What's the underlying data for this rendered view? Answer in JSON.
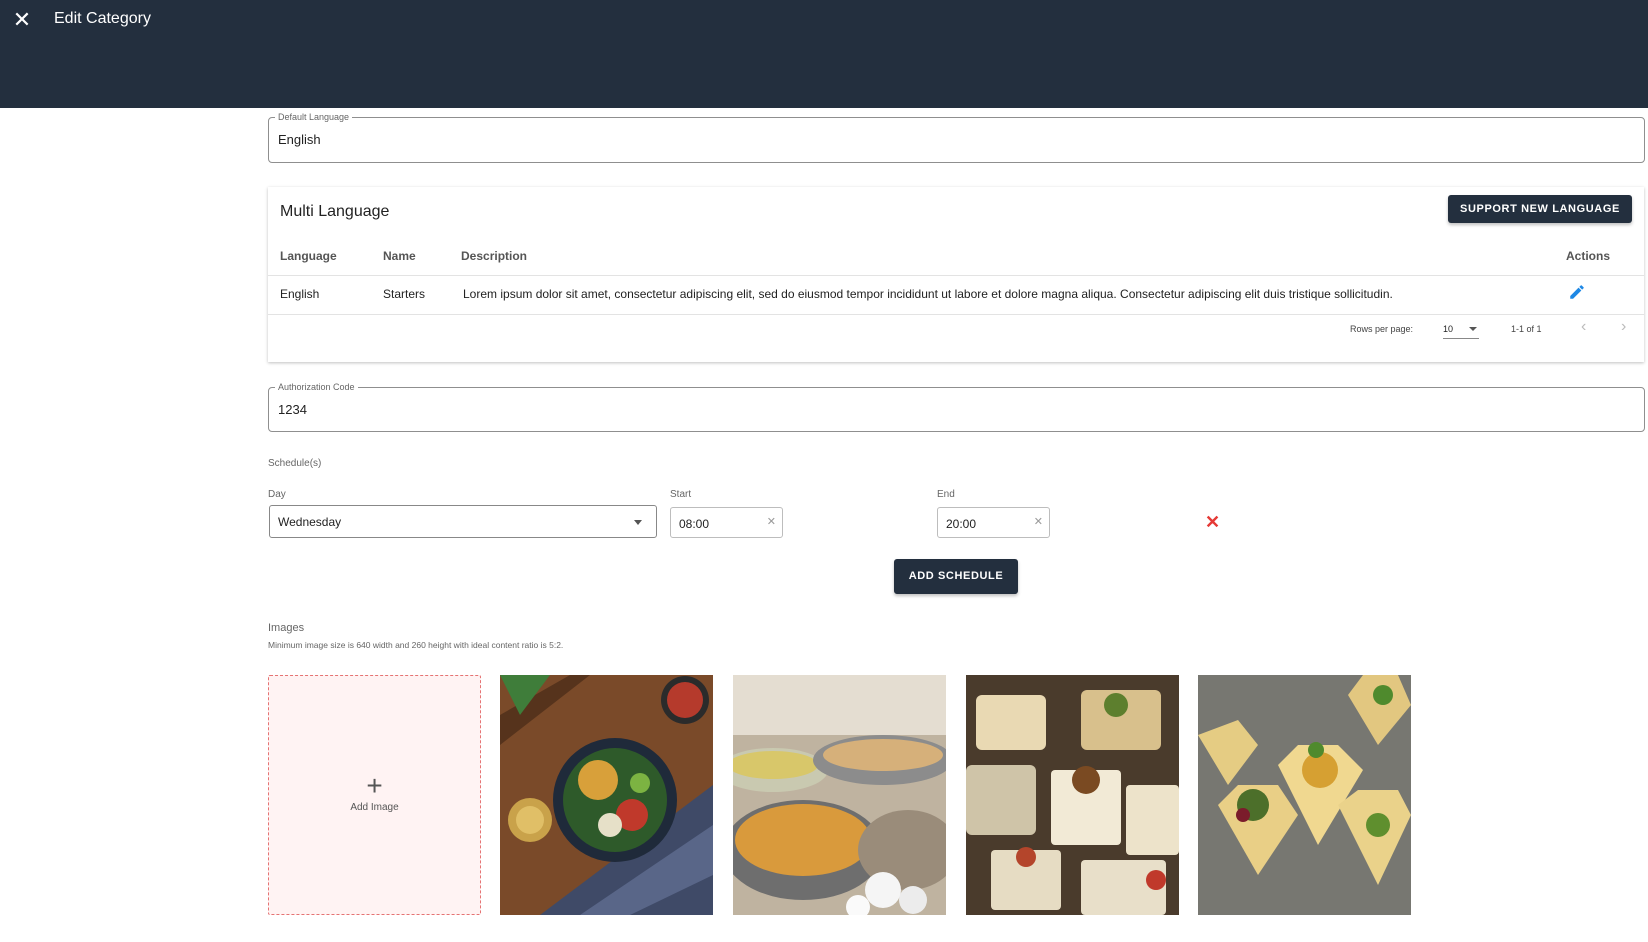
{
  "header": {
    "close_icon": "close-icon",
    "title": "Edit Category"
  },
  "default_language": {
    "legend": "Default Language",
    "value": "English"
  },
  "multi_language": {
    "title": "Multi Language",
    "support_button": "SUPPORT NEW LANGUAGE",
    "columns": {
      "language": "Language",
      "name": "Name",
      "description": "Description",
      "actions": "Actions"
    },
    "rows": [
      {
        "language": "English",
        "name": "Starters",
        "description": "Lorem ipsum dolor sit amet, consectetur adipiscing elit, sed do eiusmod tempor incididunt ut labore et dolore magna aliqua. Consectetur adipiscing elit duis tristique sollicitudin.",
        "action_icon": "pencil-icon"
      }
    ],
    "pagination": {
      "rows_per_page_label": "Rows per page:",
      "rows_per_page": "10",
      "range": "1-1 of 1"
    }
  },
  "authorization": {
    "legend": "Authorization Code",
    "value": "1234"
  },
  "schedules": {
    "label": "Schedule(s)",
    "day_label": "Day",
    "start_label": "Start",
    "end_label": "End",
    "items": [
      {
        "day": "Wednesday",
        "start": "08:00",
        "end": "20:00"
      }
    ],
    "add_button": "ADD SCHEDULE"
  },
  "images": {
    "label": "Images",
    "hint": "Minimum image size is 640 width and 260 height with ideal content ratio is 5:2.",
    "add_label": "Add Image",
    "items": [
      {
        "icon": "photo-salad-bowl"
      },
      {
        "icon": "photo-buffet-trays"
      },
      {
        "icon": "photo-canapes"
      },
      {
        "icon": "photo-pastry-cups"
      }
    ]
  },
  "colors": {
    "header_bg": "#232f3e",
    "accent": "#1e88e5",
    "danger": "#e53935",
    "add_image_bg": "#fff3f3"
  }
}
